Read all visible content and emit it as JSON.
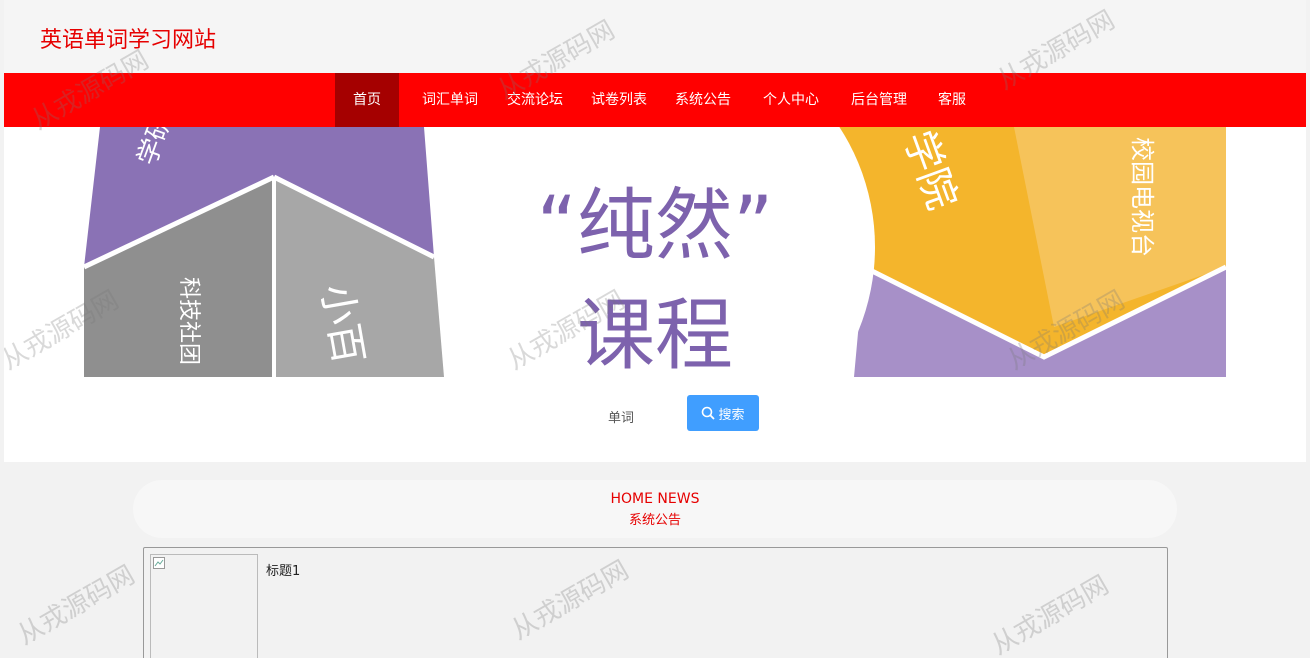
{
  "header": {
    "site_title": "英语单词学习网站"
  },
  "nav": {
    "items": [
      {
        "label": "首页",
        "active": true
      },
      {
        "label": "词汇单词"
      },
      {
        "label": "交流论坛"
      },
      {
        "label": "试卷列表"
      },
      {
        "label": "系统公告"
      },
      {
        "label": "个人中心"
      },
      {
        "label": "后台管理"
      },
      {
        "label": "客服"
      }
    ]
  },
  "banner": {
    "center_quote": "“纯然”",
    "center_line2": "课程",
    "seg_top_left": "学研",
    "seg_left": "科技社团",
    "seg_mid_left": "小百",
    "seg_top_right": "学院",
    "seg_right": "校园电视台"
  },
  "search": {
    "label": "单词",
    "button_label": "搜索"
  },
  "news": {
    "heading_en": "HOME NEWS",
    "heading_cn": "系统公告",
    "items": [
      {
        "title": "标题1"
      }
    ]
  },
  "watermark": "从戎源码网",
  "colors": {
    "brand_red": "#ff0000",
    "active_nav": "#a50000",
    "search_button": "#409eff"
  }
}
